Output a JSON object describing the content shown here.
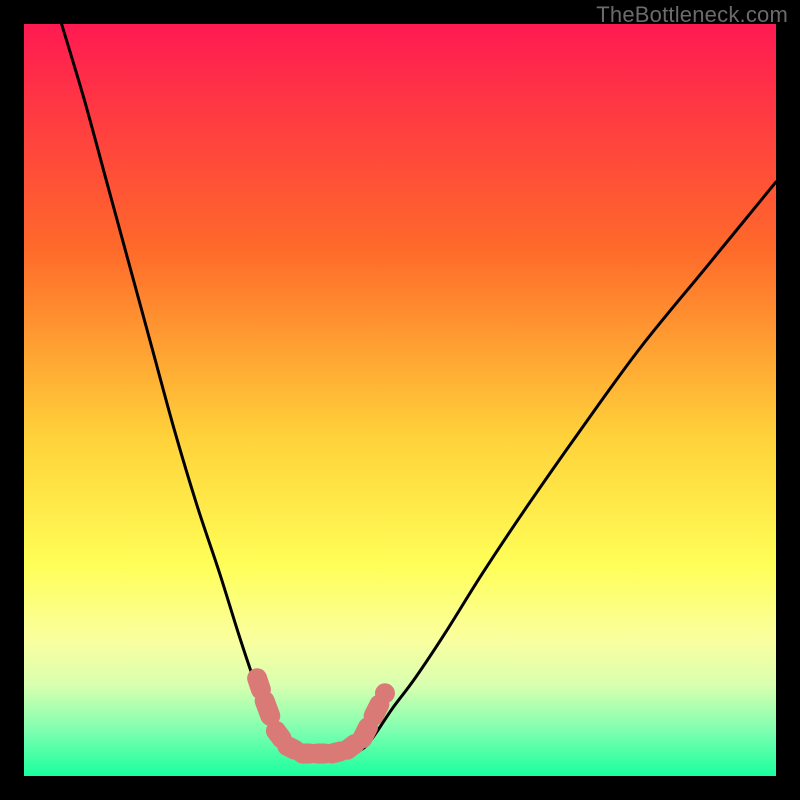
{
  "watermark": "TheBottleneck.com",
  "chart_data": {
    "type": "line",
    "title": "",
    "xlabel": "",
    "ylabel": "",
    "xlim": [
      0,
      100
    ],
    "ylim": [
      0,
      100
    ],
    "gradient_stops": [
      {
        "offset": 0,
        "color": "#ff1a52"
      },
      {
        "offset": 30,
        "color": "#ff6a2a"
      },
      {
        "offset": 55,
        "color": "#ffd23a"
      },
      {
        "offset": 72,
        "color": "#ffff58"
      },
      {
        "offset": 82,
        "color": "#faffa0"
      },
      {
        "offset": 88,
        "color": "#d8ffb0"
      },
      {
        "offset": 94,
        "color": "#7dffb0"
      },
      {
        "offset": 100,
        "color": "#19ff9e"
      }
    ],
    "series": [
      {
        "name": "left-branch",
        "x": [
          5,
          8,
          11,
          14,
          17,
          20,
          23,
          26,
          28.5,
          30.5,
          32,
          33.5,
          35,
          36
        ],
        "y": [
          100,
          90,
          79,
          68,
          57,
          46,
          36,
          27,
          19,
          13,
          9,
          6,
          4,
          3
        ]
      },
      {
        "name": "right-branch",
        "x": [
          44,
          45.5,
          47,
          49,
          52,
          56,
          61,
          67,
          74,
          82,
          91,
          100
        ],
        "y": [
          3,
          4,
          6,
          9,
          13,
          19,
          27,
          36,
          46,
          57,
          68,
          79
        ]
      },
      {
        "name": "marker-band",
        "type": "scatter",
        "points": [
          {
            "x": 31,
            "y": 13
          },
          {
            "x": 32,
            "y": 10
          },
          {
            "x": 33.5,
            "y": 6
          },
          {
            "x": 35,
            "y": 4
          },
          {
            "x": 37,
            "y": 3
          },
          {
            "x": 39,
            "y": 3
          },
          {
            "x": 41,
            "y": 3
          },
          {
            "x": 43,
            "y": 3.5
          },
          {
            "x": 45,
            "y": 5
          },
          {
            "x": 46.5,
            "y": 8
          },
          {
            "x": 48,
            "y": 11
          }
        ],
        "color": "#d97a77",
        "size": 20
      }
    ]
  }
}
